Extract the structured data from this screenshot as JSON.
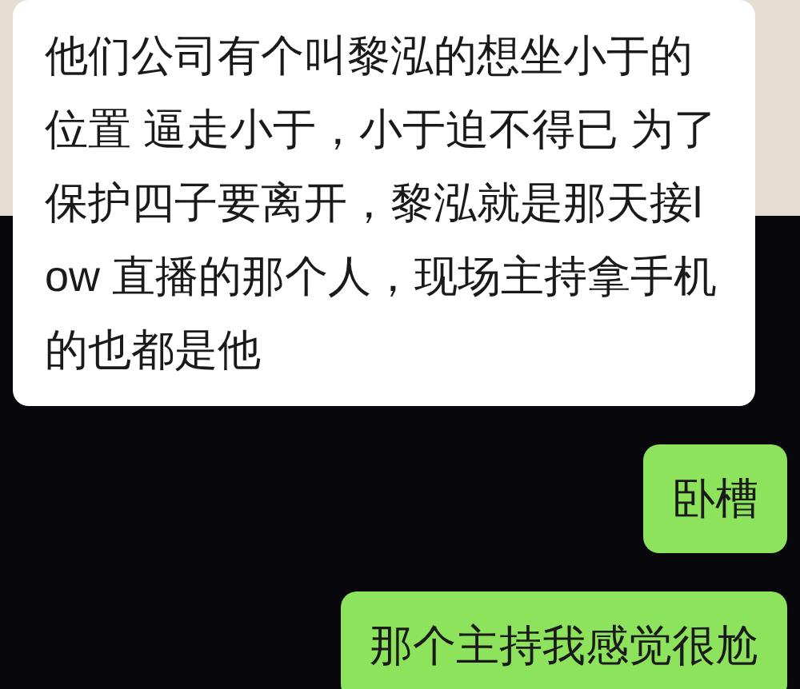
{
  "messages": [
    {
      "kind": "received",
      "text": "他们公司有个叫黎泓的想坐小于的位置 逼走小于，小于迫不得已 为了保护四子要离开，黎泓就是那天接low 直播的那个人，现场主持拿手机的也都是他"
    },
    {
      "kind": "sent",
      "text": "卧槽"
    },
    {
      "kind": "sent",
      "text": "那个主持我感觉很尬"
    }
  ]
}
